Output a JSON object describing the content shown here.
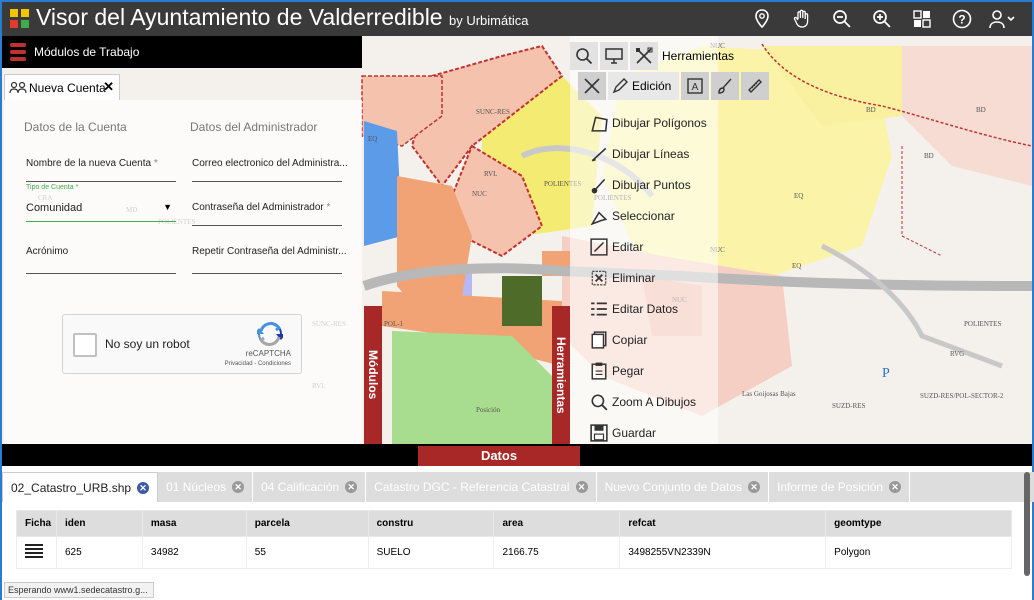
{
  "header": {
    "title": "Visor del Ayuntamiento de Valderredible",
    "byline": "by Urbimática",
    "icons": [
      "location-icon",
      "hand-icon",
      "zoom-out-icon",
      "zoom-in-icon",
      "layers-icon",
      "help-icon",
      "user-icon"
    ]
  },
  "modules": {
    "header_label": "Módulos de Trabajo",
    "tab_label": "Nueva Cuenta",
    "section_account": "Datos de la Cuenta",
    "section_admin": "Datos del Administrador",
    "field_account_name": "Nombre de la nueva Cuenta",
    "field_account_type_label": "Tipo de Cuenta",
    "field_account_type_value": "Comunidad",
    "field_acronym": "Acrónimo",
    "field_admin_email": "Correo electronico del Administra...",
    "field_admin_password": "Contraseña del Administrador",
    "field_admin_password_repeat": "Repetir Contraseña del Administr...",
    "required_mark": "*",
    "captcha_text": "No soy un robot",
    "captcha_brand": "reCAPTCHA",
    "captcha_links": "Privacidad - Condiciones"
  },
  "side_tabs": {
    "modules": "Módulos",
    "tools": "Herramientas"
  },
  "tools": {
    "header_label": "Herramientas",
    "sub_label": "Edición",
    "items": [
      {
        "label": "Dibujar Polígonos",
        "icon": "polygon-icon"
      },
      {
        "label": "Dibujar Líneas",
        "icon": "line-icon"
      },
      {
        "label": "Dibujar Puntos",
        "icon": "point-icon"
      },
      {
        "label": "Seleccionar",
        "icon": "select-icon"
      },
      {
        "label": "Editar",
        "icon": "edit-icon"
      },
      {
        "label": "Eliminar",
        "icon": "delete-icon"
      },
      {
        "label": "Editar Datos",
        "icon": "edit-data-icon"
      },
      {
        "label": "Copiar",
        "icon": "copy-icon"
      },
      {
        "label": "Pegar",
        "icon": "paste-icon"
      },
      {
        "label": "Zoom A Dibujos",
        "icon": "zoom-drawings-icon"
      },
      {
        "label": "Guardar",
        "icon": "save-icon"
      }
    ]
  },
  "map_labels": [
    "SUNC-RES",
    "SUNC-RES",
    "EQ",
    "NUC",
    "RVL",
    "POLIENTES",
    "POLIENTES",
    "EQ",
    "NUC",
    "CRA",
    "MD",
    "POLIENTES",
    "SUNC-RES",
    "RVL",
    "NUC",
    "POL-1",
    "Posición",
    "NUC",
    "POLIENTES",
    "RVG",
    "SUZD-RES",
    "SUZD-RES/POL-SECTOR-2",
    "EQ",
    "BD",
    "BD",
    "BD",
    "P",
    "Las Goijosas Bajas"
  ],
  "datos": {
    "button_label": "Datos",
    "tabs": [
      "02_Catastro_URB.shp",
      "01 Núcleos",
      "04 Calificación",
      "Catastro DGC - Referencia Catastral",
      "Nuevo Conjunto de Datos",
      "Informe de Posición"
    ],
    "columns": [
      "Ficha",
      "iden",
      "masa",
      "parcela",
      "constru",
      "area",
      "refcat",
      "geomtype"
    ],
    "rows": [
      [
        "",
        "625",
        "34982",
        "55",
        "SUELO",
        "2166.75",
        "3498255VN2339N",
        "Polygon"
      ]
    ]
  },
  "status_text": "Esperando www1.sedecatastro.g..."
}
